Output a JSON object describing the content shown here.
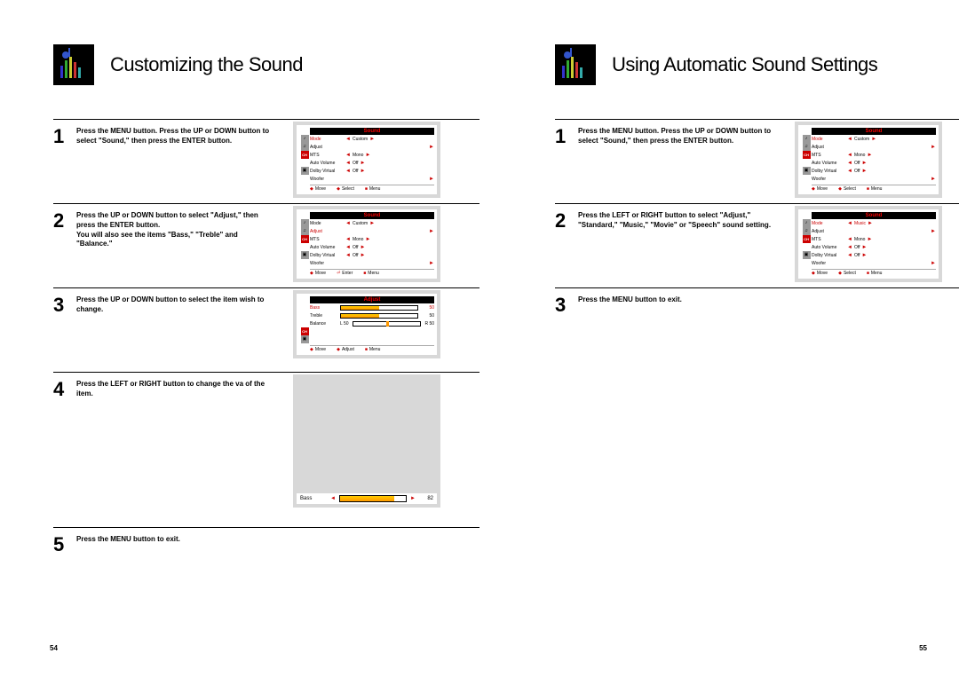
{
  "left": {
    "title": "Customizing the Sound",
    "steps": {
      "s1": "Press the MENU button. Press the UP or DOWN button to select \"Sound,\" then press the ENTER button.",
      "s2": "Press the UP or DOWN button to select \"Adjust,\" then press the ENTER button.\nYou will also see the items \"Bass,\" \"Treble\" and \"Balance.\"",
      "s3": "Press the UP or DOWN button to select the item wish to change.",
      "s4": "Press the LEFT or RIGHT button to change the va of the item.",
      "s5": "Press the MENU button to exit."
    }
  },
  "right": {
    "title": "Using Automatic Sound Settings",
    "steps": {
      "s1": "Press the MENU button. Press the UP or DOWN button to select \"Sound,\" then press the ENTER button.",
      "s2": "Press the LEFT or RIGHT button to select \"Adjust,\" \"Standard,\" \"Music,\" \"Movie\" or \"Speech\" sound setting.",
      "s3": "Press the MENU button to exit."
    }
  },
  "osd": {
    "sound_title": "Sound",
    "adjust_title": "Adjust",
    "rows": {
      "mode": "Mode",
      "adjust": "Adjust",
      "mts": "MTS",
      "autovol": "Auto Volume",
      "dolby": "Dolby Virtual",
      "woofer": "Woofer"
    },
    "vals": {
      "custom": "Custom",
      "music": "Music",
      "mono": "Mono",
      "off": "Off"
    },
    "adjust_rows": {
      "bass": "Bass",
      "treble": "Treble",
      "balance": "Balance",
      "l50": "L 50",
      "r50": "R 50",
      "v50": "50"
    },
    "foot": {
      "move": "Move",
      "select": "Select",
      "enter": "Enter",
      "adjust": "Adjust",
      "menu": "Menu"
    },
    "inline": {
      "label": "Bass",
      "value": "82",
      "pct": 82
    }
  },
  "pagenum": {
    "left": "54",
    "right": "55"
  }
}
